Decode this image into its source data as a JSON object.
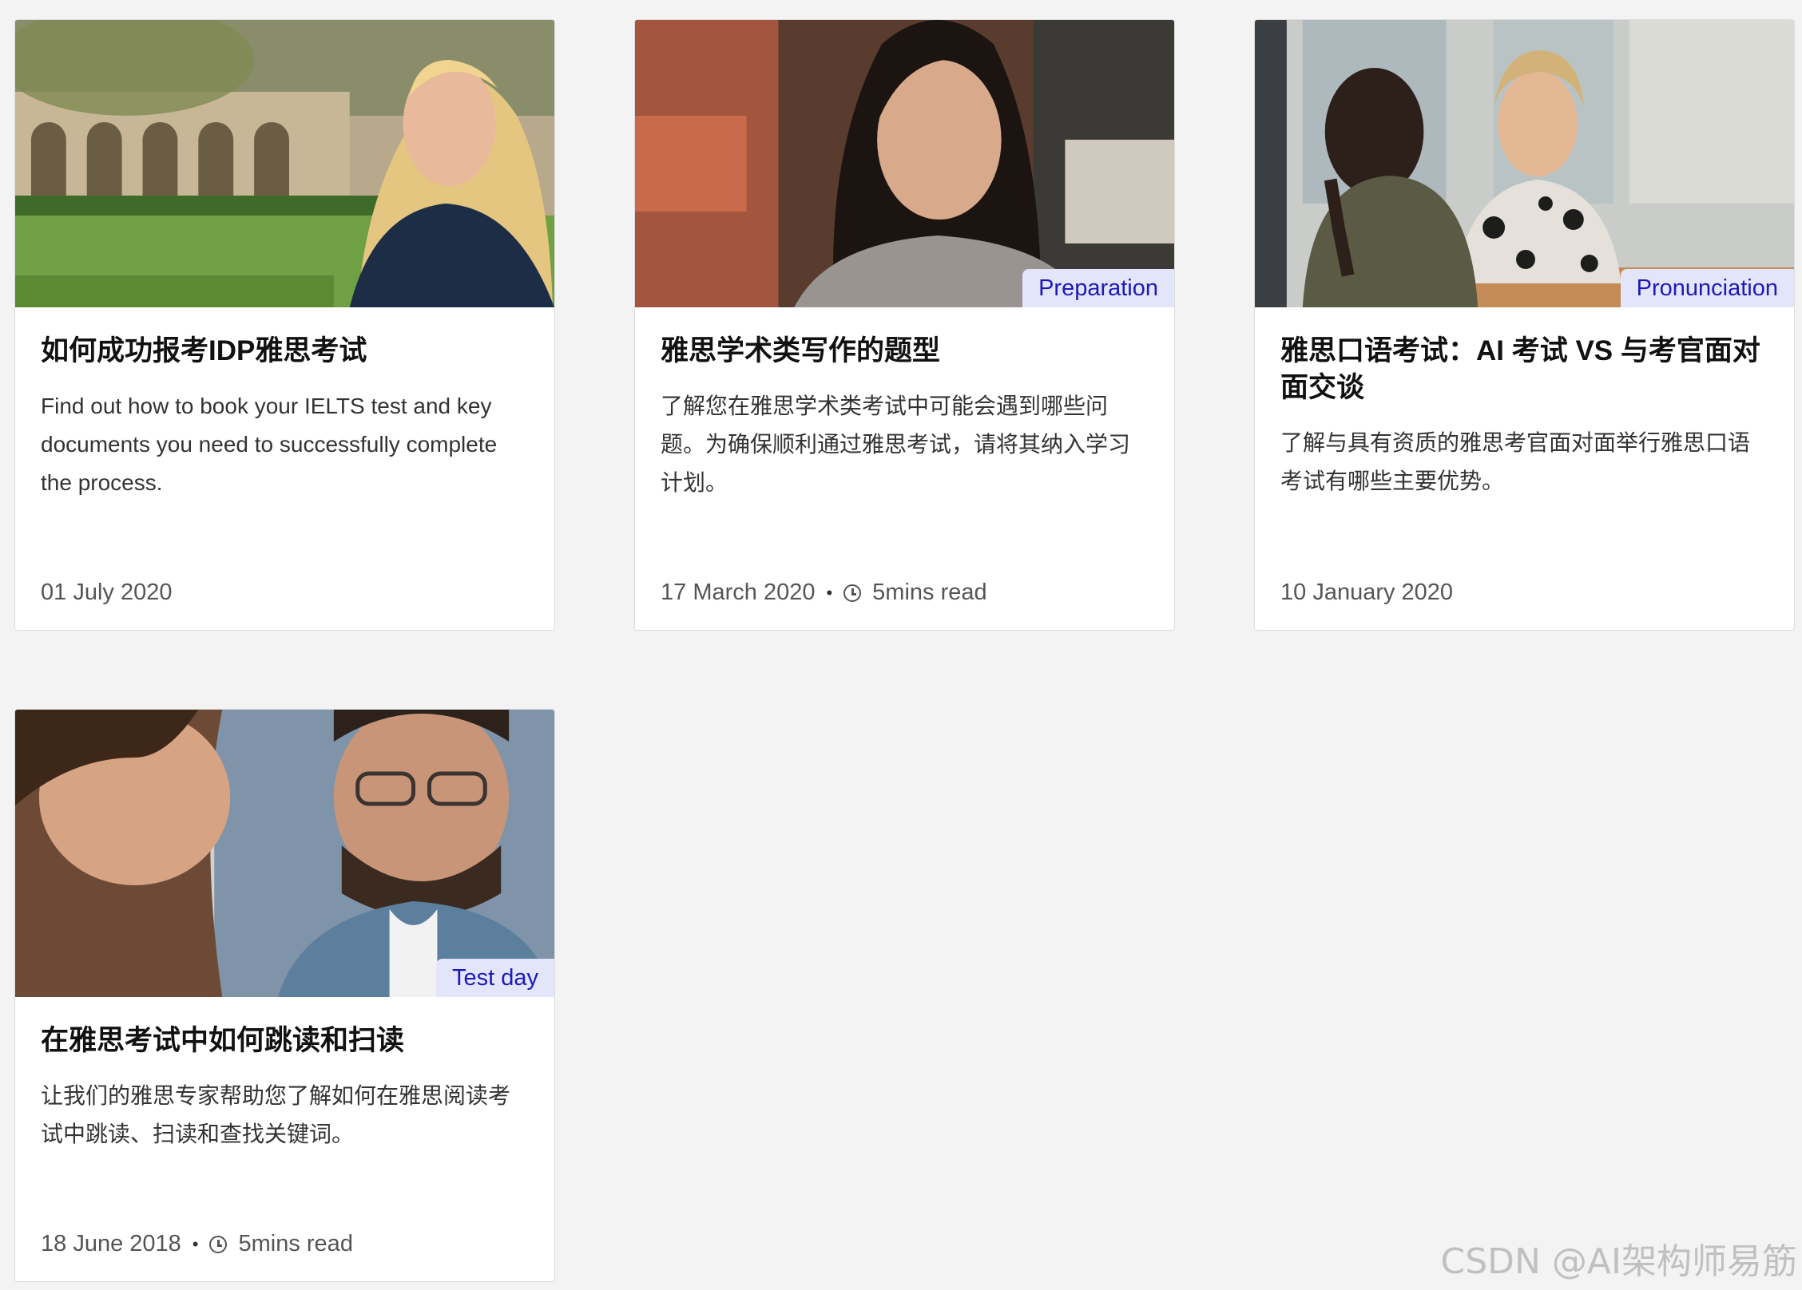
{
  "cards": [
    {
      "title": "如何成功报考IDP雅思考试",
      "description": "Find out how to book your IELTS test and key documents you need to successfully complete the process.",
      "date": "01 July 2020",
      "tag": "",
      "read_time": ""
    },
    {
      "title": "雅思学术类写作的题型",
      "description": "了解您在雅思学术类考试中可能会遇到哪些问题。为确保顺利通过雅思考试，请将其纳入学习计划。",
      "date": "17 March 2020",
      "tag": "Preparation",
      "read_time": "5mins read"
    },
    {
      "title": "雅思口语考试：AI 考试 VS 与考官面对面交谈",
      "description": "了解与具有资质的雅思考官面对面举行雅思口语考试有哪些主要优势。",
      "date": "10 January 2020",
      "tag": "Pronunciation",
      "read_time": ""
    },
    {
      "title": "在雅思考试中如何跳读和扫读",
      "description": "让我们的雅思专家帮助您了解如何在雅思阅读考试中跳读、扫读和查找关键词。",
      "date": "18 June 2018",
      "tag": "Test day",
      "read_time": "5mins read"
    }
  ],
  "watermark": "CSDN @AI架构师易筋",
  "colors": {
    "tag_bg": "#e3e5fb",
    "tag_text": "#1d1ab8",
    "page_bg": "#f3f3f3"
  }
}
